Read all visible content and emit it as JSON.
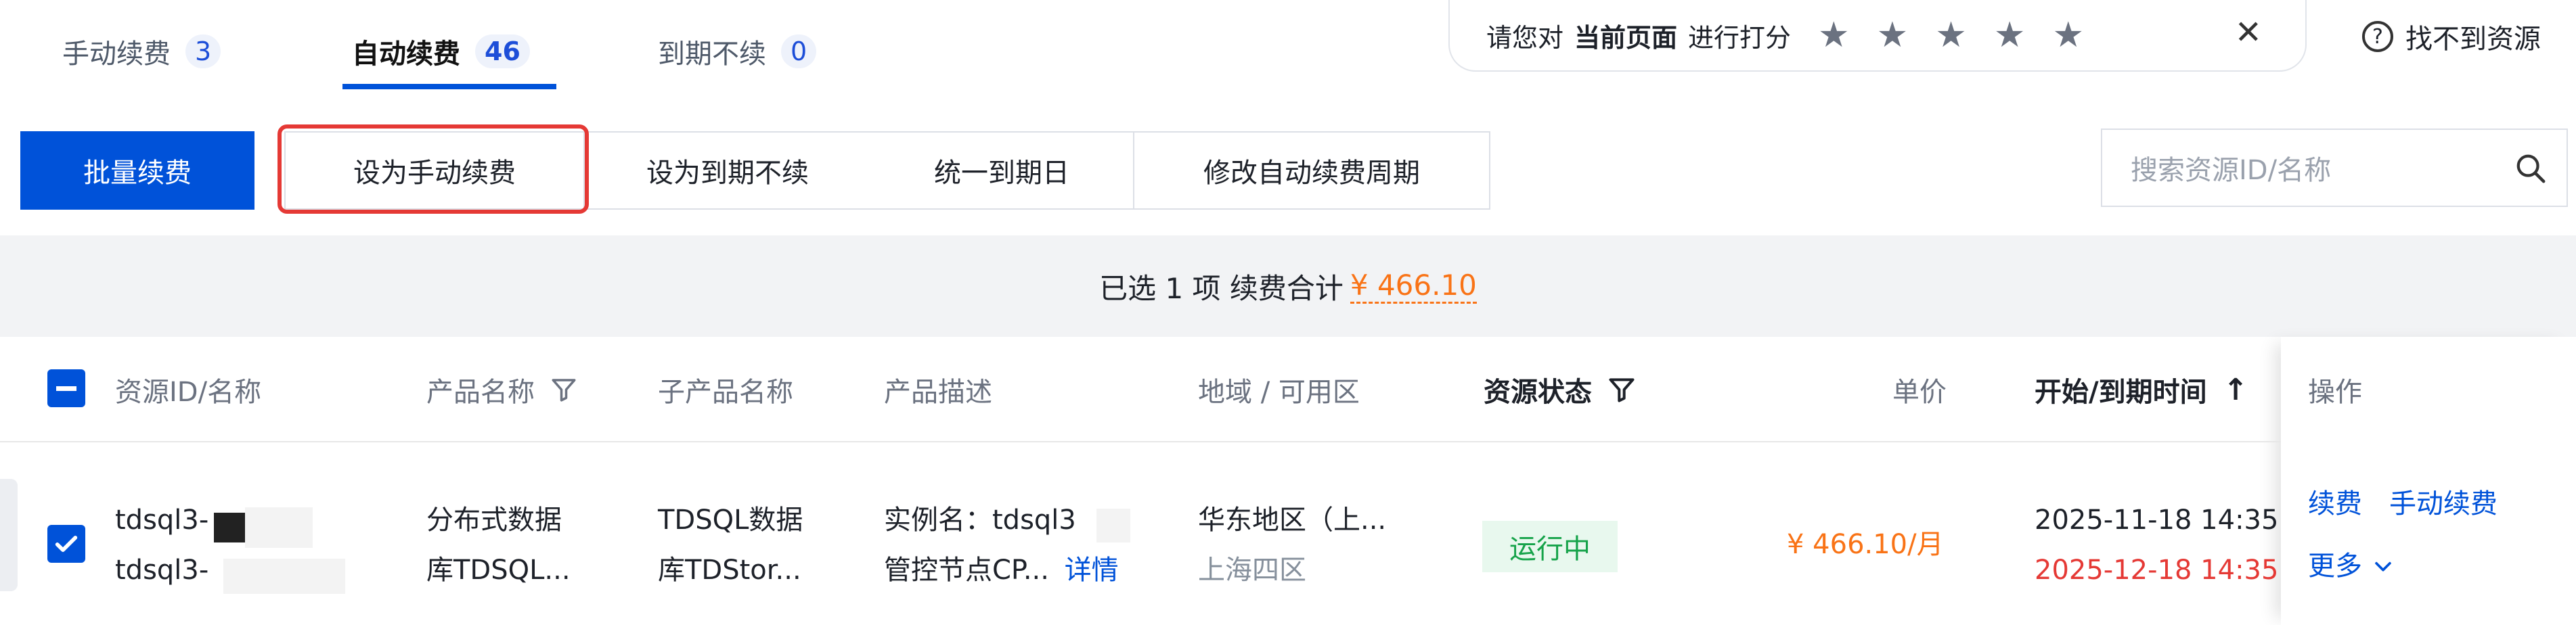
{
  "tabs": [
    {
      "label": "手动续费",
      "count": "3"
    },
    {
      "label": "自动续费",
      "count": "46"
    },
    {
      "label": "到期不续",
      "count": "0"
    }
  ],
  "rating": {
    "prefix": "请您对",
    "bold": "当前页面",
    "suffix": "进行打分",
    "close": "✕"
  },
  "help_label": "找不到资源",
  "toolbar": {
    "batch": "批量续费",
    "set_manual": "设为手动续费",
    "set_no_renew": "设为到期不续",
    "unify_date": "统一到期日",
    "modify_cycle": "修改自动续费周期"
  },
  "search": {
    "placeholder": "搜索资源ID/名称"
  },
  "summary": {
    "text": "已选 1 项 续费合计",
    "amount": "¥ 466.10"
  },
  "columns": {
    "resource": "资源ID/名称",
    "product": "产品名称",
    "subproduct": "子产品名称",
    "desc": "产品描述",
    "region": "地域 / 可用区",
    "status": "资源状态",
    "price": "单价",
    "time": "开始/到期时间",
    "ops": "操作"
  },
  "row": {
    "id1": "tdsql3-",
    "id2": "tdsql3-",
    "product1": "分布式数据",
    "product2": "库TDSQL...",
    "sub1": "TDSQL数据",
    "sub2": "库TDStor...",
    "desc1": "实例名：tdsql3",
    "desc2": "管控节点CP...",
    "desc_link": "详情",
    "region1": "华东地区（上...",
    "region2": "上海四区",
    "status": "运行中",
    "price": "¥ 466.10/月",
    "start": "2025-11-18 14:35",
    "end": "2025-12-18 14:35",
    "op_renew": "续费",
    "op_manual": "手动续费",
    "op_more": "更多"
  }
}
